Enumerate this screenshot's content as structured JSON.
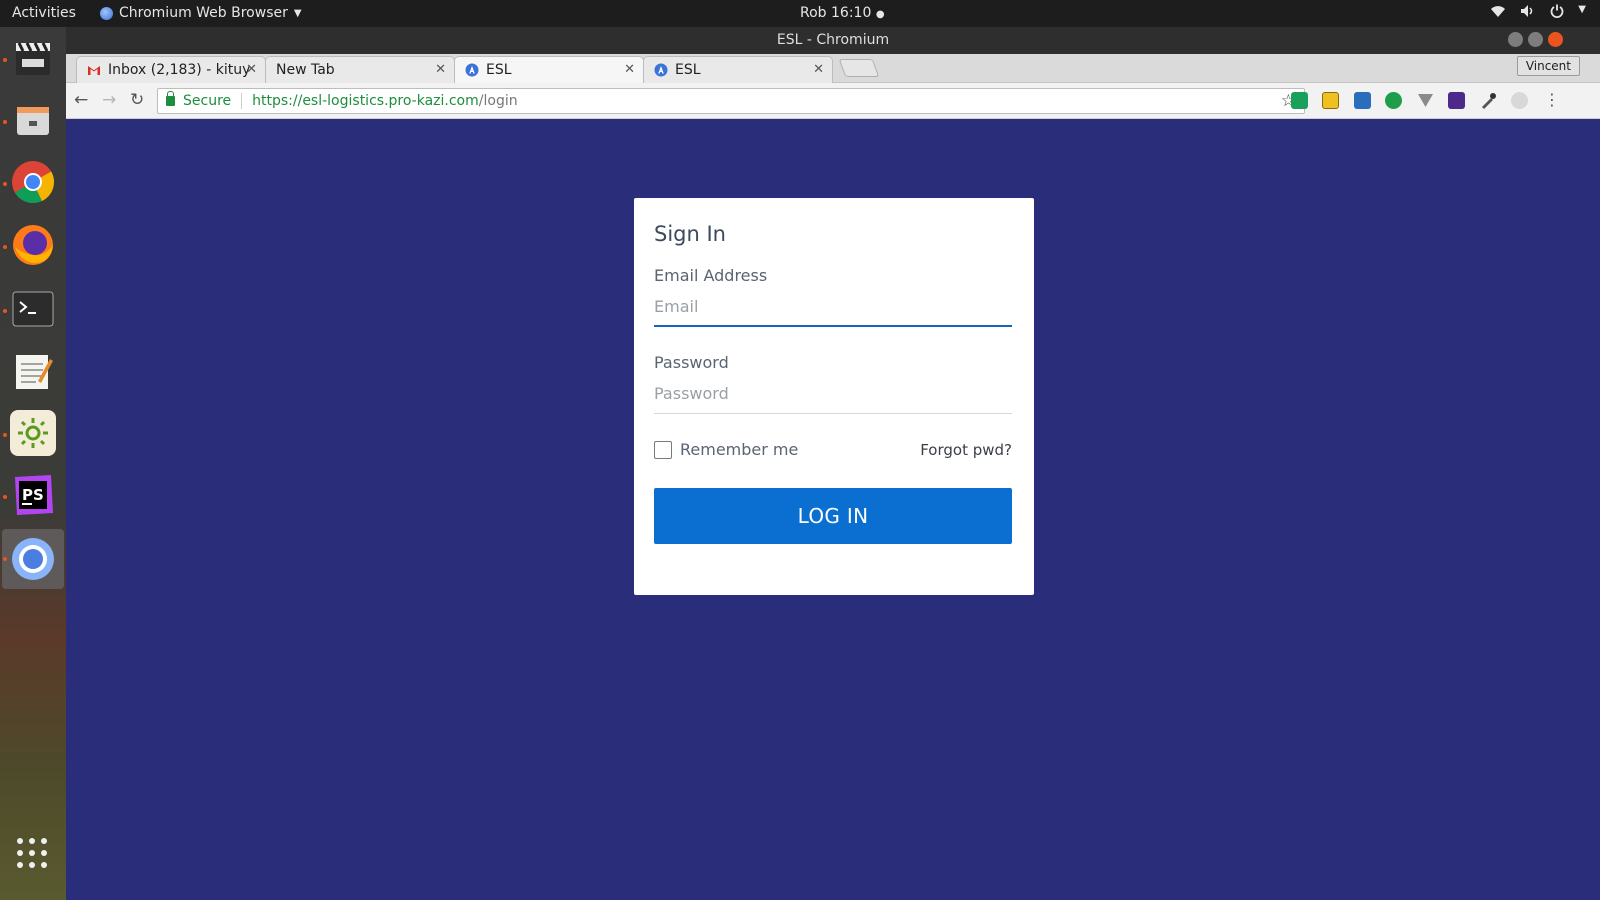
{
  "topbar": {
    "activities": "Activities",
    "app_menu": "Chromium Web Browser",
    "clock": "Rob 16:10"
  },
  "dock": {
    "apps": [
      "clapperboard-icon",
      "files-icon",
      "chrome-icon",
      "firefox-icon",
      "terminal-icon",
      "text-editor-icon",
      "settings-sun-icon",
      "phpstorm-icon",
      "chromium-icon"
    ]
  },
  "window": {
    "title": "ESL - Chromium"
  },
  "tabs": [
    {
      "label": "Inbox (2,183) - kituy",
      "icon": "gmail-icon"
    },
    {
      "label": "New Tab",
      "icon": ""
    },
    {
      "label": "ESL",
      "icon": "angular-icon"
    },
    {
      "label": "ESL",
      "icon": "angular-icon"
    }
  ],
  "profile": "Vincent",
  "omnibox": {
    "secure": "Secure",
    "url_scheme_host": "https://esl-logistics.pro-kazi.com",
    "url_path": "/login"
  },
  "login": {
    "title": "Sign In",
    "email_label": "Email Address",
    "email_placeholder": "Email",
    "password_label": "Password",
    "password_placeholder": "Password",
    "remember": "Remember me",
    "forgot": "Forgot pwd?",
    "button": "LOG IN"
  },
  "colors": {
    "page_bg": "#2a2e7a",
    "button": "#0a6fd0",
    "secure_green": "#1e8e3e"
  }
}
